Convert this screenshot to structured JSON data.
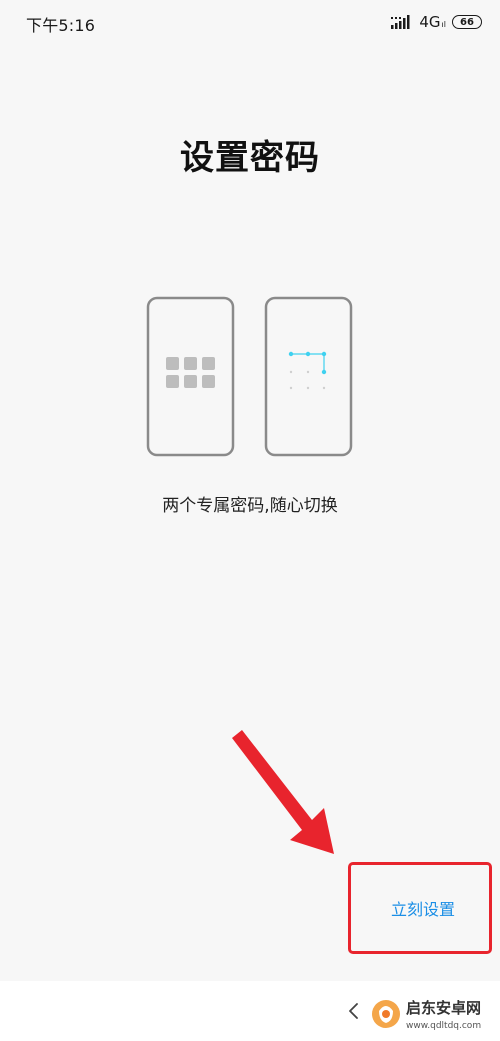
{
  "status_bar": {
    "time": "下午5:16",
    "network": "4G",
    "network_sub": "ıl",
    "battery": "66",
    "icons": [
      "signal-icon",
      "battery-icon"
    ]
  },
  "page": {
    "title": "设置密码",
    "subtitle": "两个专属密码,随心切换"
  },
  "actions": {
    "setup_label": "立刻设置"
  },
  "annotation": {
    "arrow_color": "#e8242d",
    "box_color": "#e8242d"
  },
  "colors": {
    "accent": "#1a8ee6",
    "pattern_dot": "#3fd1f0",
    "background": "#f7f7f7"
  },
  "watermark": {
    "name": "启东安卓网",
    "url": "www.qdltdq.com"
  }
}
